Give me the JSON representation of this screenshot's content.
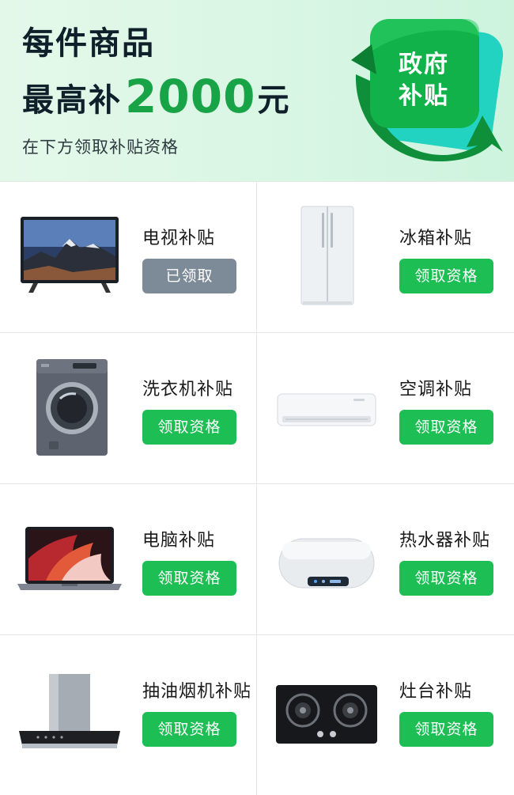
{
  "banner": {
    "title_line1": "每件商品",
    "title_line2_prefix": "最高补",
    "amount": "2000",
    "unit": "元",
    "subtitle": "在下方领取补贴资格",
    "badge_line1": "政府",
    "badge_line2": "补贴"
  },
  "colors": {
    "accent": "#1dbe54",
    "amount": "#19a347",
    "claimed": "#7d8b99"
  },
  "items": [
    {
      "label": "电视补贴",
      "button": "已领取",
      "status": "claimed",
      "icon": "tv-image"
    },
    {
      "label": "冰箱补贴",
      "button": "领取资格",
      "status": "available",
      "icon": "refrigerator-image"
    },
    {
      "label": "洗衣机补贴",
      "button": "领取资格",
      "status": "available",
      "icon": "washing-machine-image"
    },
    {
      "label": "空调补贴",
      "button": "领取资格",
      "status": "available",
      "icon": "air-conditioner-image"
    },
    {
      "label": "电脑补贴",
      "button": "领取资格",
      "status": "available",
      "icon": "laptop-image"
    },
    {
      "label": "热水器补贴",
      "button": "领取资格",
      "status": "available",
      "icon": "water-heater-image"
    },
    {
      "label": "抽油烟机补贴",
      "button": "领取资格",
      "status": "available",
      "icon": "range-hood-image"
    },
    {
      "label": "灶台补贴",
      "button": "领取资格",
      "status": "available",
      "icon": "gas-stove-image"
    }
  ]
}
